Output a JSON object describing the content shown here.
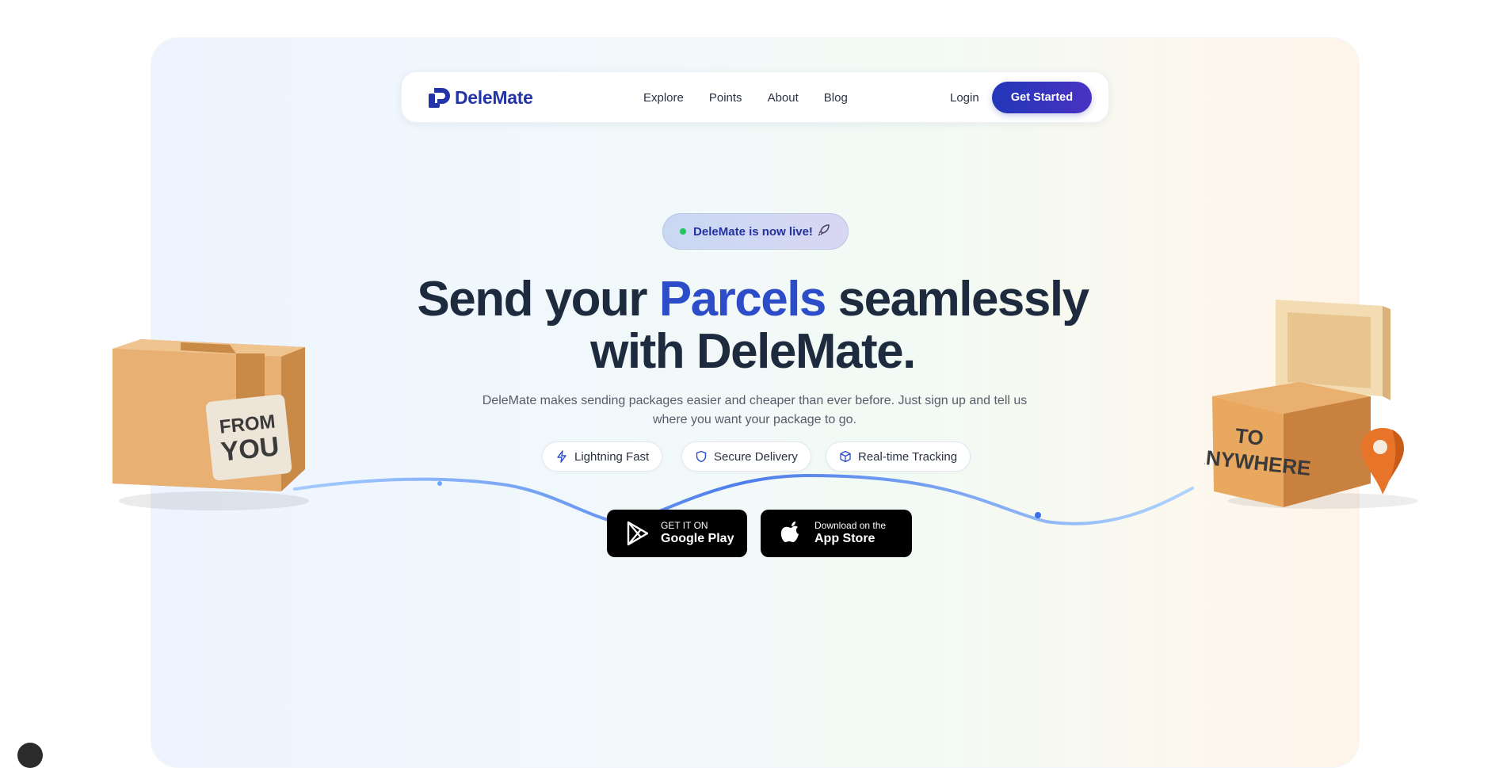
{
  "brand": {
    "name": "DeleMate"
  },
  "nav": {
    "links": [
      "Explore",
      "Points",
      "About",
      "Blog"
    ],
    "login": "Login",
    "cta": "Get Started"
  },
  "badge": {
    "text": "DeleMate is now live!",
    "icon": "rocket-icon"
  },
  "hero": {
    "title_part1": "Send your ",
    "title_accent": "Parcels",
    "title_part2": " seamlessly",
    "title_line2": "with DeleMate.",
    "subtitle": "DeleMate makes sending packages easier and cheaper than ever before. Just sign up and tell us where you want your package to go."
  },
  "features": [
    {
      "label": "Lightning Fast",
      "icon": "lightning-icon"
    },
    {
      "label": "Secure Delivery",
      "icon": "shield-icon"
    },
    {
      "label": "Real-time Tracking",
      "icon": "box-icon"
    }
  ],
  "stores": {
    "google": {
      "small": "GET IT ON",
      "big": "Google Play"
    },
    "apple": {
      "small": "Download on the",
      "big": "App Store"
    }
  },
  "illustrations": {
    "left_box_label_line1": "FROM",
    "left_box_label_line2": "YOU",
    "right_box_label_line1": "TO",
    "right_box_label_line2": "ANYWHERE"
  },
  "colors": {
    "accent": "#2c4cc8",
    "brand": "#2333a8",
    "live_dot": "#22c55e",
    "pin": "#e8742a"
  }
}
